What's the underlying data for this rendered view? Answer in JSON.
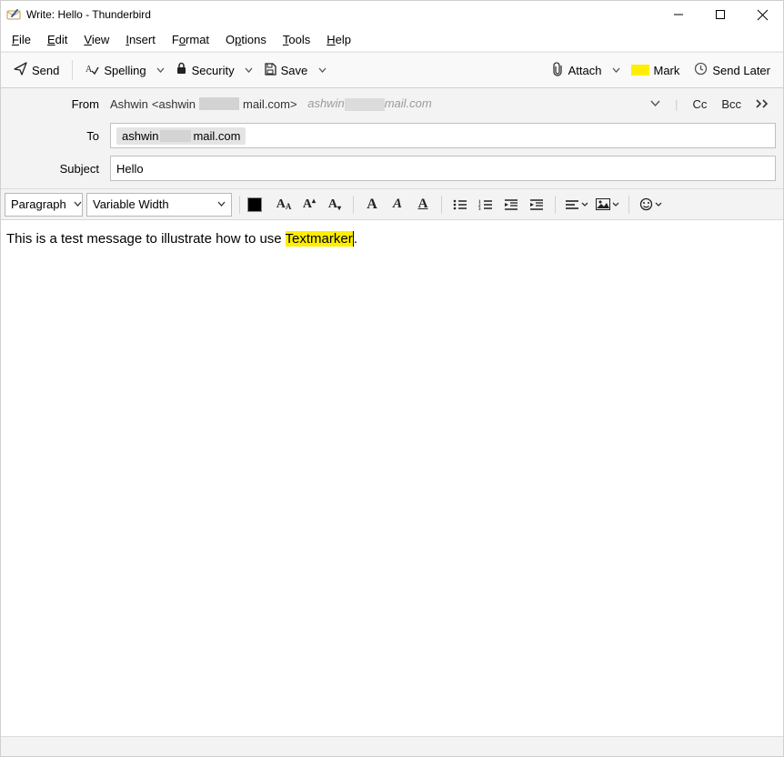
{
  "title": "Write: Hello - Thunderbird",
  "menu": {
    "file": "File",
    "edit": "Edit",
    "view": "View",
    "insert": "Insert",
    "format": "Format",
    "options": "Options",
    "tools": "Tools",
    "help": "Help"
  },
  "toolbar": {
    "send": "Send",
    "spelling": "Spelling",
    "security": "Security",
    "save": "Save",
    "attach": "Attach",
    "mark": "Mark",
    "sendlater": "Send Later"
  },
  "headers": {
    "from_label": "From",
    "from_name": "Ashwin",
    "from_open": "<ashwin",
    "from_close": "mail.com>",
    "from_gray_pre": "ashwin",
    "from_gray_post": "mail.com",
    "cc": "Cc",
    "bcc": "Bcc",
    "to_label": "To",
    "to_pre": "ashwin",
    "to_post": "mail.com",
    "subject_label": "Subject",
    "subject_value": "Hello"
  },
  "format": {
    "para": "Paragraph",
    "font": "Variable Width"
  },
  "body": {
    "pre": "This is a test message to illustrate how to use ",
    "hl": "Textmarker",
    "post": "."
  }
}
